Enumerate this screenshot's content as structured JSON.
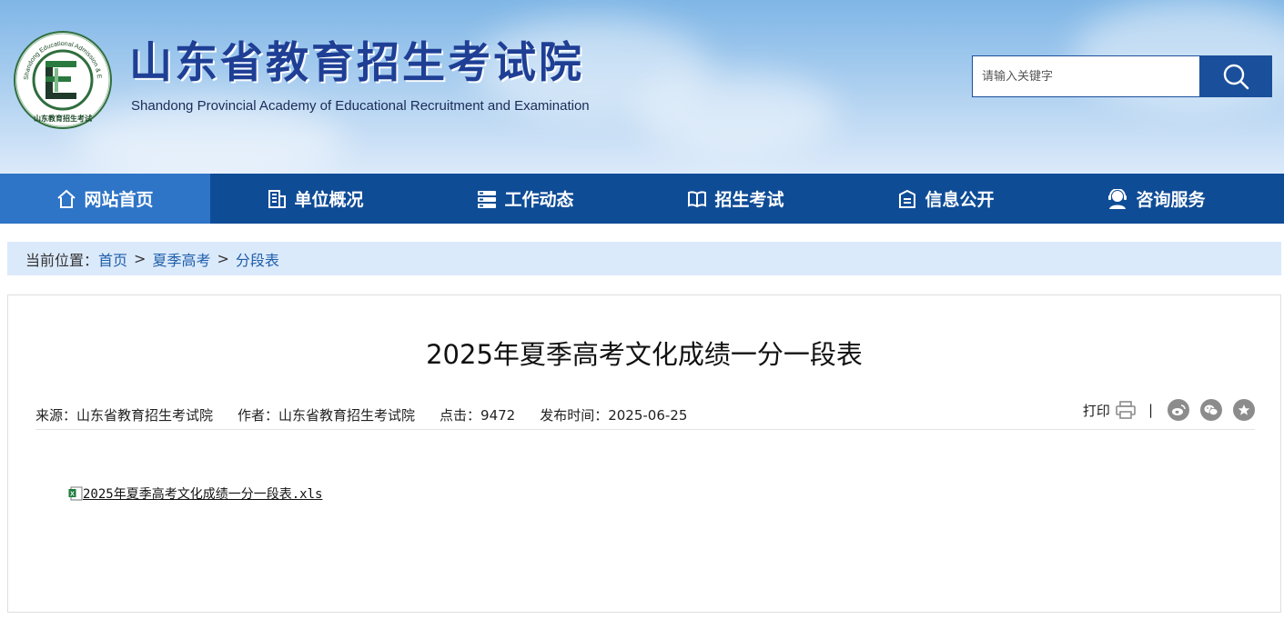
{
  "header": {
    "logo_cn": "山东省教育招生考试院",
    "logo_en": "Shandong Provincial Academy of Educational Recruitment and Examination",
    "emblem_ring_text": "Shandong Educational Admission & Examination",
    "emblem_bottom_text": "山东教育招生考试",
    "emblem_letter": "E"
  },
  "search": {
    "placeholder": "请输入关键字"
  },
  "nav": {
    "items": [
      {
        "label": "网站首页",
        "icon": "home-icon"
      },
      {
        "label": "单位概况",
        "icon": "building-icon"
      },
      {
        "label": "工作动态",
        "icon": "server-icon"
      },
      {
        "label": "招生考试",
        "icon": "book-icon"
      },
      {
        "label": "信息公开",
        "icon": "document-icon"
      },
      {
        "label": "咨询服务",
        "icon": "support-icon"
      }
    ]
  },
  "breadcrumb": {
    "prefix": "当前位置：",
    "items": [
      "首页",
      "夏季高考",
      "分段表"
    ],
    "separator": ">"
  },
  "article": {
    "title": "2025年夏季高考文化成绩一分一段表",
    "source": "来源：山东省教育招生考试院",
    "author": "作者：山东省教育招生考试院",
    "clicks": "点击：9472",
    "publish_time": "发布时间：2025-06-25",
    "print_label": "打印",
    "divider": "|",
    "attachment": "2025年夏季高考文化成绩一分一段表.xls"
  },
  "colors": {
    "nav_bg": "#0f4c96",
    "nav_active": "#2e74c7",
    "breadcrumb_bg": "#dbeafb",
    "link": "#1f5eaa"
  }
}
